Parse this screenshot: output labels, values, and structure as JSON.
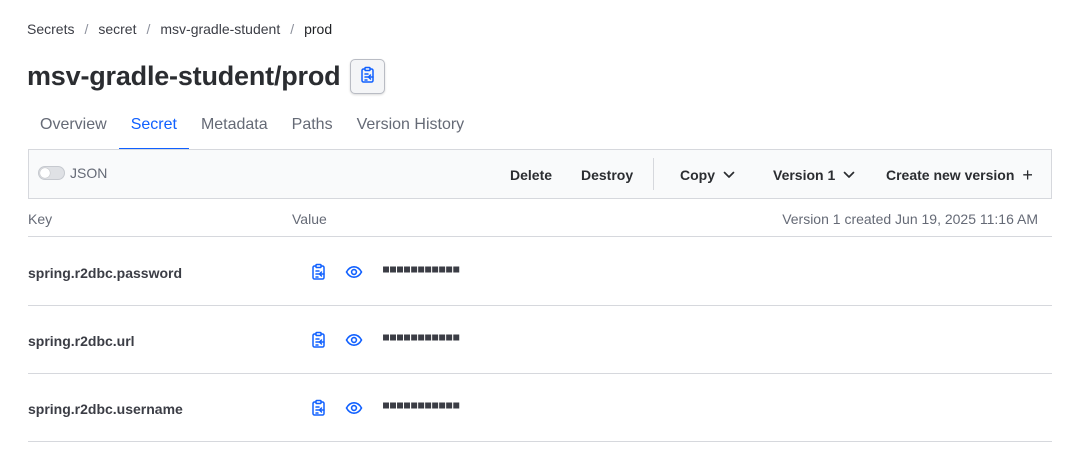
{
  "breadcrumb": [
    "Secrets",
    "secret",
    "msv-gradle-student",
    "prod"
  ],
  "breadcrumb_separator": "/",
  "page_title": "msv-gradle-student/prod",
  "tabs": [
    "Overview",
    "Secret",
    "Metadata",
    "Paths",
    "Version History"
  ],
  "active_tab": "Secret",
  "toolbar": {
    "json_label": "JSON",
    "json_enabled": false,
    "delete_label": "Delete",
    "destroy_label": "Destroy",
    "copy_label": "Copy",
    "version_label": "Version 1",
    "create_label": "Create new version",
    "create_icon": "+"
  },
  "table": {
    "key_header": "Key",
    "value_header": "Value",
    "version_info": "Version 1 created Jun 19, 2025 11:16 AM",
    "rows": [
      {
        "key": "spring.r2dbc.password",
        "masked": "■■■■■■■■■■■"
      },
      {
        "key": "spring.r2dbc.url",
        "masked": "■■■■■■■■■■■"
      },
      {
        "key": "spring.r2dbc.username",
        "masked": "■■■■■■■■■■■"
      }
    ]
  },
  "icons": {
    "title_copy": "clipboard-copy-icon",
    "row_copy": "clipboard-copy-icon",
    "row_reveal": "eye-icon",
    "dropdown": "chevron-down-icon"
  },
  "colors": {
    "accent": "#1060ff",
    "text": "#2b2d31",
    "muted": "#656a76",
    "border": "#d6d8dd",
    "toolbar_bg": "#f9fafb"
  }
}
